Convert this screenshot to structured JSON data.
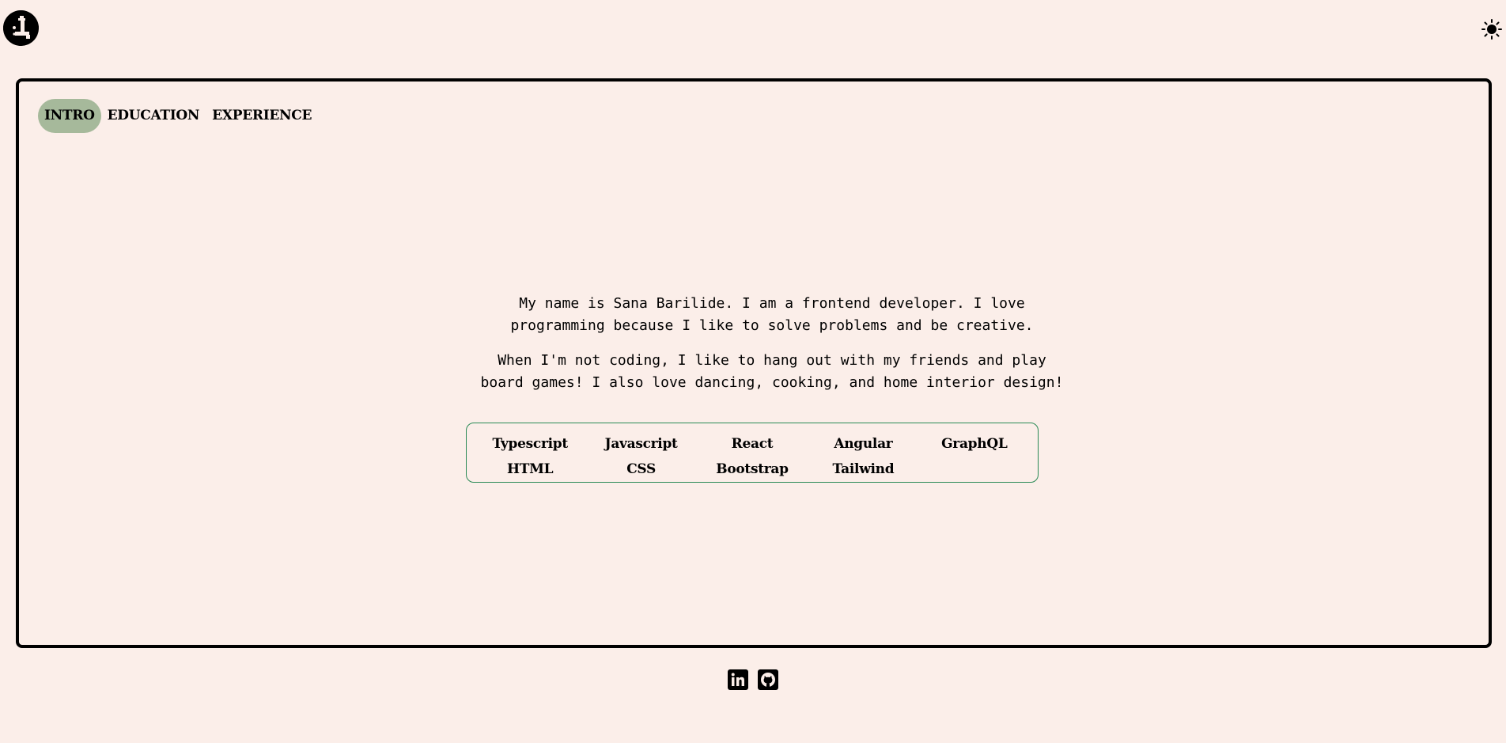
{
  "header": {
    "logo_icon": "logo-icon",
    "theme_toggle_icon": "sun-icon"
  },
  "tabs": [
    {
      "label": "INTRO",
      "active": true
    },
    {
      "label": "EDUCATION",
      "active": false
    },
    {
      "label": "EXPERIENCE",
      "active": false
    }
  ],
  "intro": {
    "paragraph1": "My name is Sana Barilide. I am a frontend developer. I love programming because I like to solve problems and be creative.",
    "paragraph2": "When I'm not coding, I like to hang out with my friends and play board games! I also love dancing, cooking, and home interior design!"
  },
  "skills": [
    "Typescript",
    "Javascript",
    "React",
    "Angular",
    "GraphQL",
    "HTML",
    "CSS",
    "Bootstrap",
    "Tailwind"
  ],
  "footer": {
    "social_icons": [
      "linkedin-icon",
      "github-icon"
    ]
  },
  "colors": {
    "background": "#fbeee9",
    "active_tab": "#a6b99b",
    "skills_border": "#2a8a55",
    "text": "#000000"
  }
}
